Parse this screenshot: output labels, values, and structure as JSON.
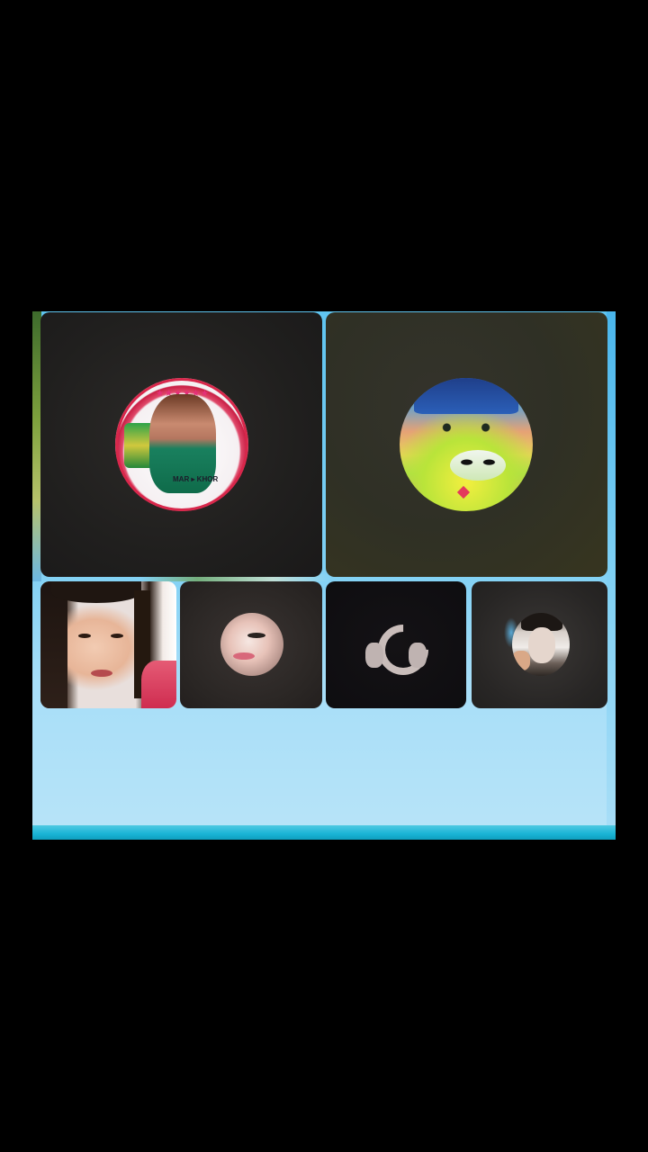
{
  "call": {
    "participants": [
      {
        "kind": "avatar",
        "icon": "badge-avatar-icon"
      },
      {
        "kind": "avatar",
        "icon": "joker-avatar-icon"
      },
      {
        "kind": "video",
        "icon": "person-video"
      },
      {
        "kind": "avatar",
        "icon": "face-avatar-icon"
      },
      {
        "kind": "avatar",
        "icon": "heart-hands-avatar-icon"
      },
      {
        "kind": "avatar",
        "icon": "man-avatar-icon"
      }
    ],
    "badge_text": {
      "stars": "★★★★★★",
      "lower": "MAR ▸ KHOR"
    }
  },
  "colors": {
    "background": "#000000",
    "stage_sky": "#7fd0f4",
    "tile_dark": "#201f1e",
    "accent_ring": "#d8274b"
  }
}
